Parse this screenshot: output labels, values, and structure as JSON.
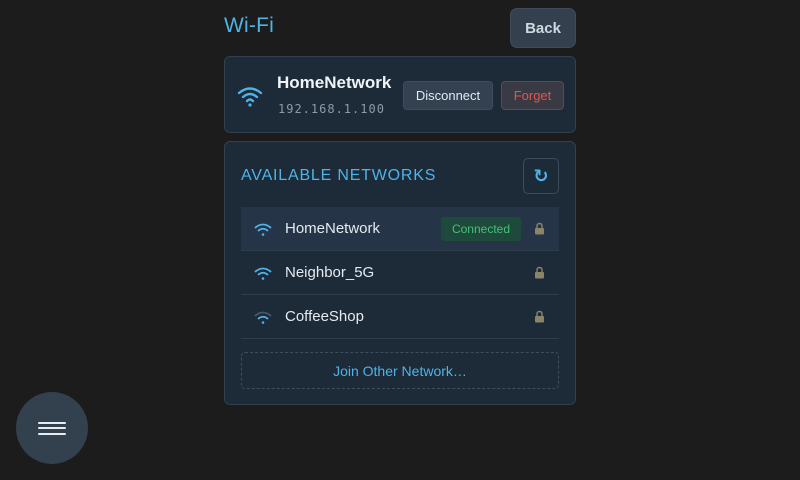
{
  "header": {
    "title": "Wi-Fi",
    "back_label": "Back"
  },
  "current_network": {
    "ssid": "HomeNetwork",
    "ip": "192.168.1.100",
    "disconnect_label": "Disconnect",
    "forget_label": "Forget",
    "icon": "wifi-icon"
  },
  "available": {
    "title": "AVAILABLE NETWORKS",
    "refresh_icon": "refresh-icon",
    "networks": [
      {
        "name": "HomeNetwork",
        "badge": "Connected",
        "signal_bars": 3,
        "secured": true,
        "connected": true
      },
      {
        "name": "Neighbor_5G",
        "badge": "",
        "signal_bars": 3,
        "secured": true,
        "connected": false
      },
      {
        "name": "CoffeeShop",
        "badge": "",
        "signal_bars": 1,
        "secured": true,
        "connected": false
      }
    ],
    "join_label": "Join Other Network…"
  },
  "menu": {
    "icon": "hamburger-menu-icon"
  },
  "colors": {
    "accent": "#4fb3e8",
    "background": "#1c1c1c",
    "card": "#1d2a38",
    "danger": "#e0564f",
    "success": "#45c07a"
  }
}
